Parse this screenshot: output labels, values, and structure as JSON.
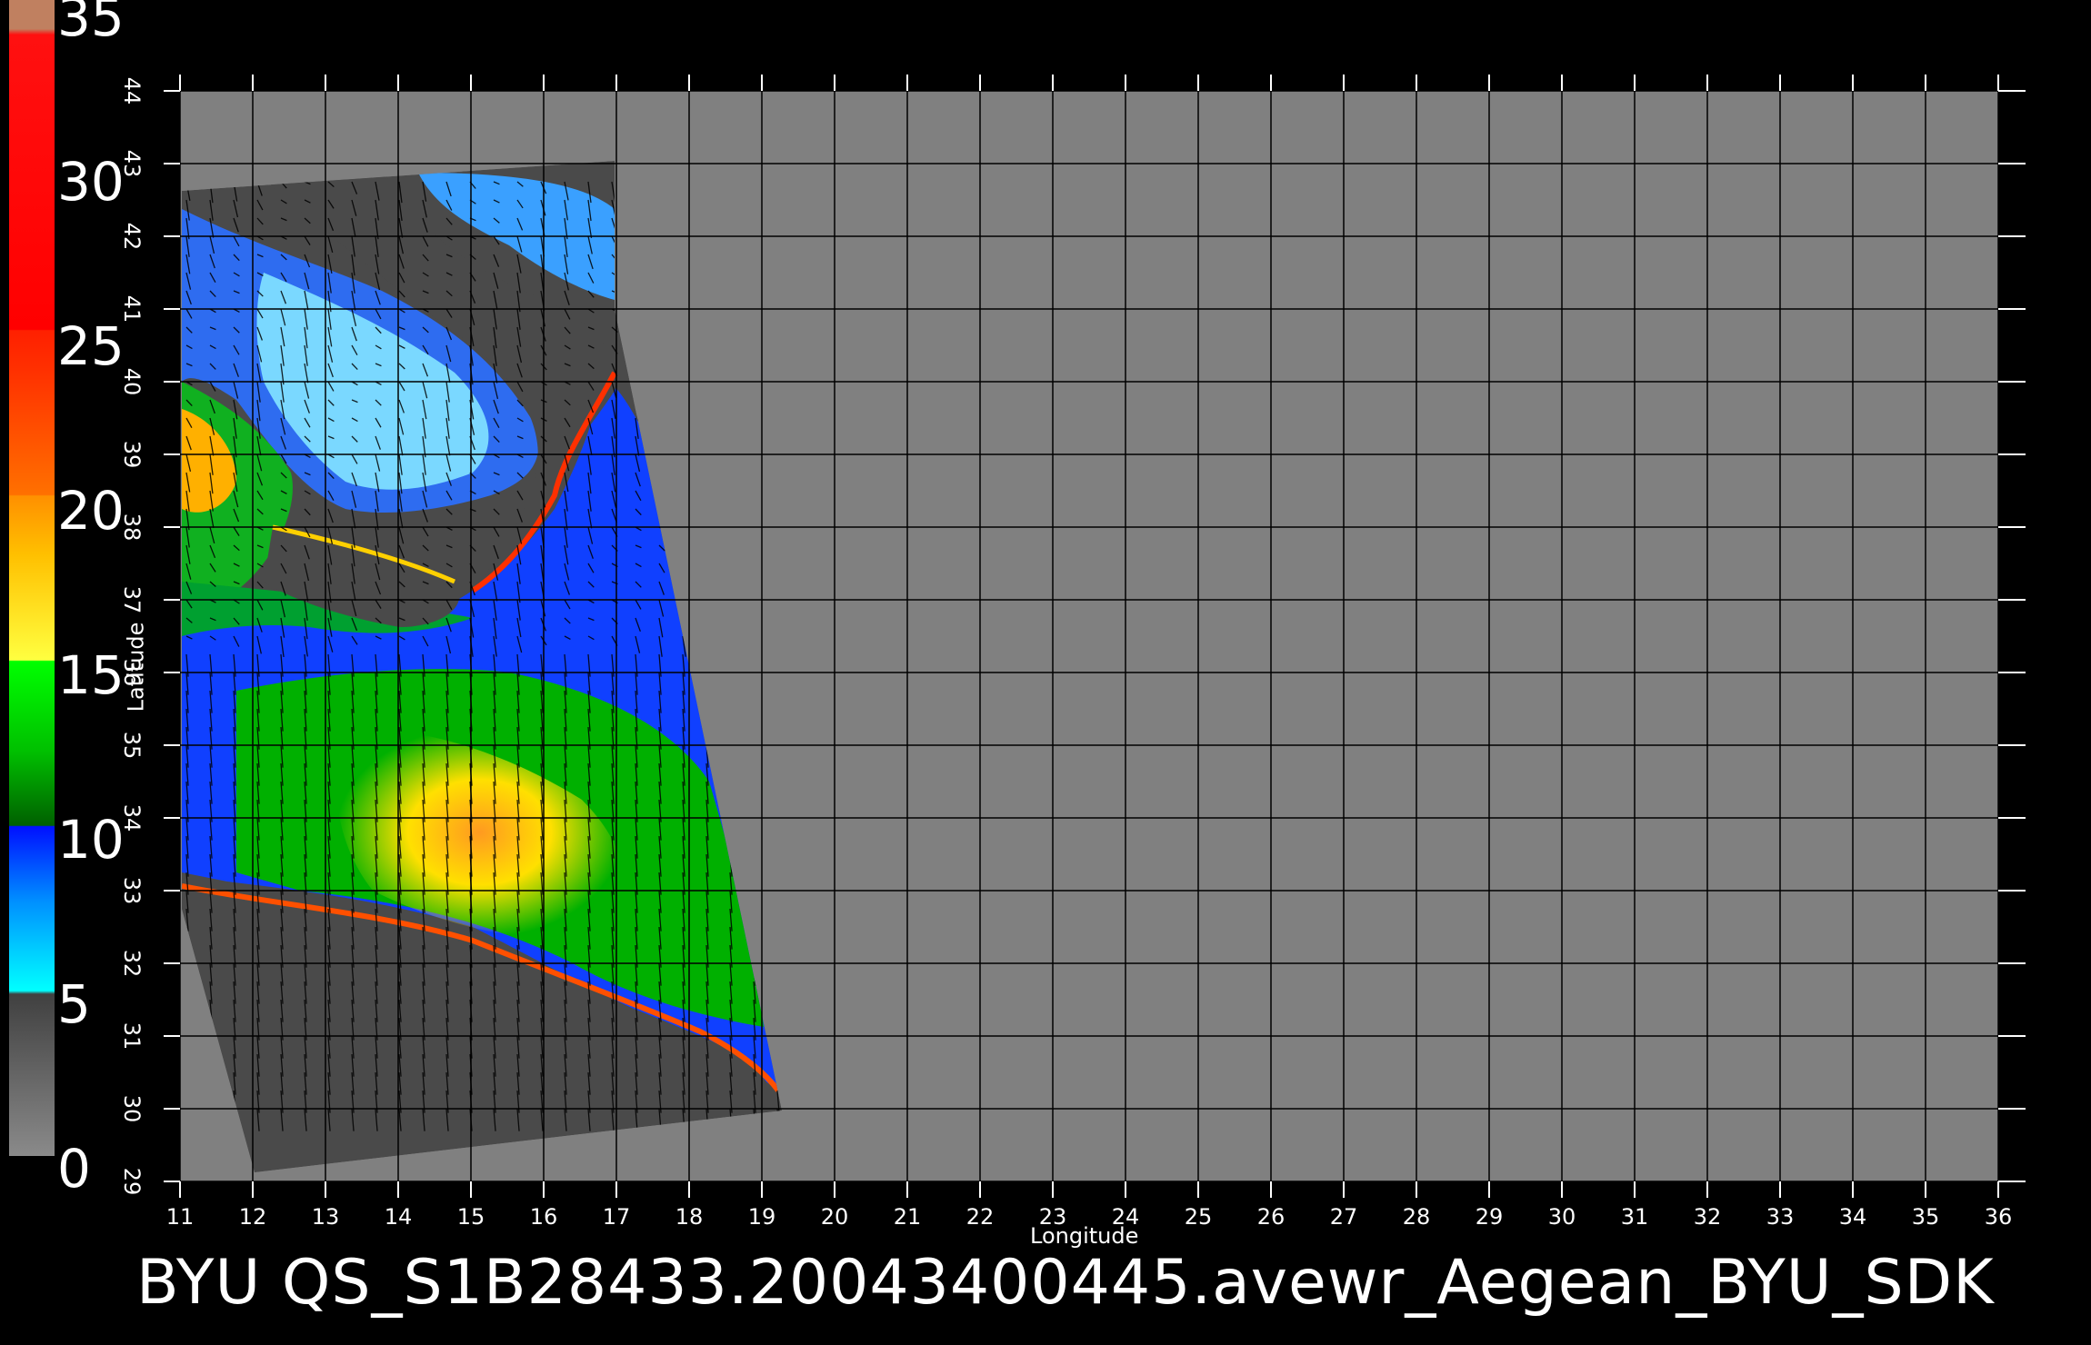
{
  "colorbar": {
    "labels": [
      "35",
      "30",
      "25",
      "20",
      "15",
      "10",
      "5",
      "0"
    ]
  },
  "chart_data": {
    "type": "heatmap",
    "title": "BYU  QS_S1B28433.20043400445.avewr_Aegean_BYU_SDK",
    "xlabel": "Longitude",
    "ylabel": "Latitude",
    "xlim": [
      11,
      36
    ],
    "ylim": [
      29,
      44
    ],
    "x_ticks": [
      "11",
      "12",
      "13",
      "14",
      "15",
      "16",
      "17",
      "18",
      "19",
      "20",
      "21",
      "22",
      "23",
      "24",
      "25",
      "26",
      "27",
      "28",
      "29",
      "30",
      "31",
      "32",
      "33",
      "34",
      "35",
      "36"
    ],
    "y_ticks": [
      "29",
      "30",
      "31",
      "32",
      "33",
      "34",
      "35",
      "36",
      "37",
      "38",
      "39",
      "40",
      "41",
      "42",
      "43",
      "44"
    ],
    "grid": true,
    "colorscale": {
      "range": [
        0,
        35
      ],
      "colors": [
        "#606060",
        "#00e8ff",
        "#0a3cff",
        "#00a000",
        "#ffe000",
        "#ff8000",
        "#ff0000"
      ]
    },
    "colors": {
      "background": "#000000",
      "map_area": "#808080",
      "swath_nodata": "#4c4c4c",
      "grid": "#000000"
    }
  }
}
